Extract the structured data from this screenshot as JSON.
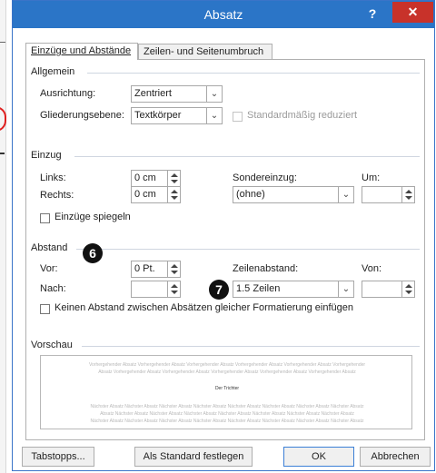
{
  "dialog": {
    "title": "Absatz",
    "help_symbol": "?",
    "close_symbol": "✕"
  },
  "tabs": [
    {
      "label": "Einzüge und Abstände",
      "active": true
    },
    {
      "label": "Zeilen- und Seitenumbruch",
      "active": false
    }
  ],
  "allgemein": {
    "section_title": "Allgemein",
    "ausrichtung_label": "Ausrichtung:",
    "ausrichtung_value": "Zentriert",
    "gliederung_label": "Gliederungsebene:",
    "gliederung_value": "Textkörper",
    "reduziert_label": "Standardmäßig reduziert"
  },
  "einzug": {
    "section_title": "Einzug",
    "links_label": "Links:",
    "links_value": "0 cm",
    "rechts_label": "Rechts:",
    "rechts_value": "0 cm",
    "sondereinzug_label": "Sondereinzug:",
    "sondereinzug_value": "(ohne)",
    "um_label": "Um:",
    "um_value": "",
    "spiegeln_label": "Einzüge spiegeln"
  },
  "abstand": {
    "section_title": "Abstand",
    "vor_label": "Vor:",
    "vor_value": "0 Pt.",
    "nach_label": "Nach:",
    "nach_value": "",
    "zeilenabstand_label": "Zeilenabstand:",
    "zeilenabstand_value": "1.5 Zeilen",
    "von_label": "Von:",
    "von_value": "",
    "keinen_abstand_label": "Keinen Abstand zwischen Absätzen gleicher Formatierung einfügen"
  },
  "vorschau": {
    "section_title": "Vorschau",
    "prev_line1": "Vorhergehender Absatz Vorhergehender Absatz Vorhergehender Absatz Vorhergehender Absatz Vorhergehender Absatz Vorhergehender",
    "prev_line2": "Absatz Vorhergehender Absatz Vorhergehender Absatz Vorhergehender Absatz Vorhergehender Absatz Vorhergehender Absatz",
    "current": "Der Trichter",
    "next_line1": "Nächster Absatz Nächster Absatz Nächster Absatz Nächster Absatz Nächster Absatz Nächster Absatz Nächster Absatz Nächster Absatz",
    "next_line2": "Absatz Nächster Absatz Nächster Absatz Nächster Absatz Nächster Absatz Nächster Absatz Nächster Absatz Nächster Absatz",
    "next_line3": "Nächster Absatz Nächster Absatz Nächster Absatz Nächster Absatz Nächster Absatz Nächster Absatz Nächster Absatz Nächster Absatz"
  },
  "buttons": {
    "tabstopps": "Tabstopps...",
    "standard": "Als Standard festlegen",
    "ok": "OK",
    "abbrechen": "Abbrechen"
  },
  "callouts": {
    "six": "6",
    "seven": "7"
  },
  "colors": {
    "titlebar": "#2b75c7",
    "close": "#c8322a",
    "section_rule": "#cfd6e0"
  }
}
